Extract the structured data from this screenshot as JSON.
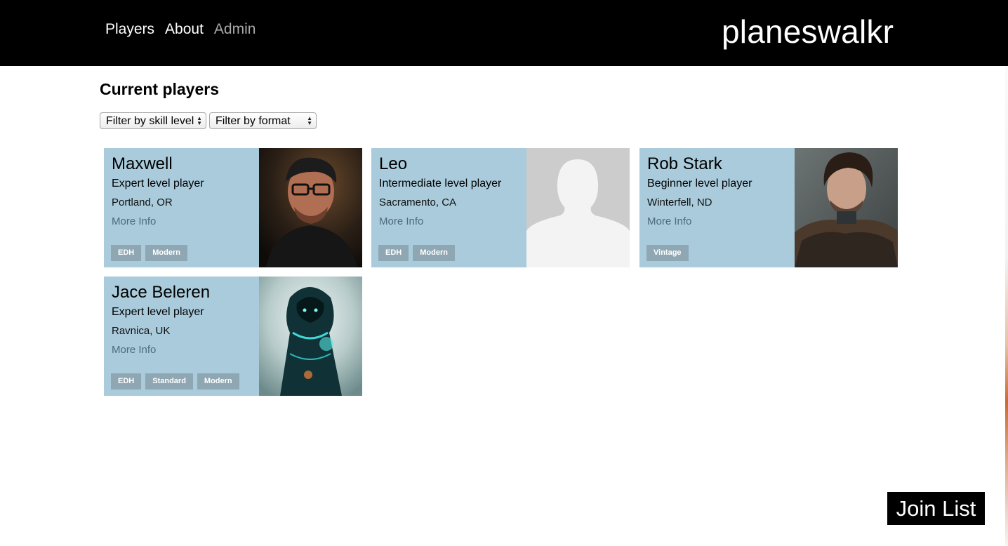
{
  "nav": {
    "players": "Players",
    "about": "About",
    "admin": "Admin"
  },
  "brand": "planeswalkr",
  "page_title": "Current players",
  "filters": {
    "skill": "Filter by skill level",
    "format": "Filter by format"
  },
  "players": [
    {
      "name": "Maxwell",
      "skill": "Expert level player",
      "location": "Portland, OR",
      "more": "More Info",
      "tags": [
        "EDH",
        "Modern"
      ]
    },
    {
      "name": "Leo",
      "skill": "Intermediate level player",
      "location": "Sacramento, CA",
      "more": "More Info",
      "tags": [
        "EDH",
        "Modern"
      ]
    },
    {
      "name": "Rob Stark",
      "skill": "Beginner level player",
      "location": "Winterfell, ND",
      "more": "More Info",
      "tags": [
        "Vintage"
      ]
    },
    {
      "name": "Jace Beleren",
      "skill": "Expert level player",
      "location": "Ravnica, UK",
      "more": "More Info",
      "tags": [
        "EDH",
        "Standard",
        "Modern"
      ]
    }
  ],
  "join_button": "Join List",
  "colors": {
    "header_bg": "#000000",
    "card_bg": "#a9cbdb",
    "tag_bg": "#8ea7b3",
    "link": "#4d6b7b"
  }
}
